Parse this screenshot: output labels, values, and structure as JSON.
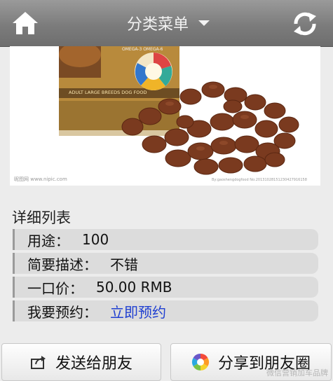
{
  "header": {
    "menu_label": "分类菜单",
    "home_icon": "home-icon",
    "refresh_icon": "refresh-icon"
  },
  "product": {
    "package_label": "ADULT LARGE BREEDS DOG FOOD",
    "package_sub": "OMEGA-3 OMEGA-6",
    "caption_left": "昵图网 www.nipic.com",
    "caption_right": "By:gaoshengdogfood No:20131028151230427916158"
  },
  "details": {
    "heading": "详细列表",
    "rows": [
      {
        "label": "用途：",
        "value": "100"
      },
      {
        "label": "简要描述：",
        "value": "不错"
      },
      {
        "label": "一口价：",
        "value": "50.00 RMB"
      },
      {
        "label": "我要预约：",
        "value": "立即预约"
      }
    ]
  },
  "actions": {
    "send_label": "发送给朋友",
    "share_label": "分享到朋友圈",
    "send_icon": "share-out-icon",
    "share_icon": "moments-icon"
  },
  "watermark": "微信营销加车品牌",
  "colors": {
    "header": "#7c7c7c",
    "link": "#1f3fd1",
    "row_bg": "#dcdcdc"
  }
}
